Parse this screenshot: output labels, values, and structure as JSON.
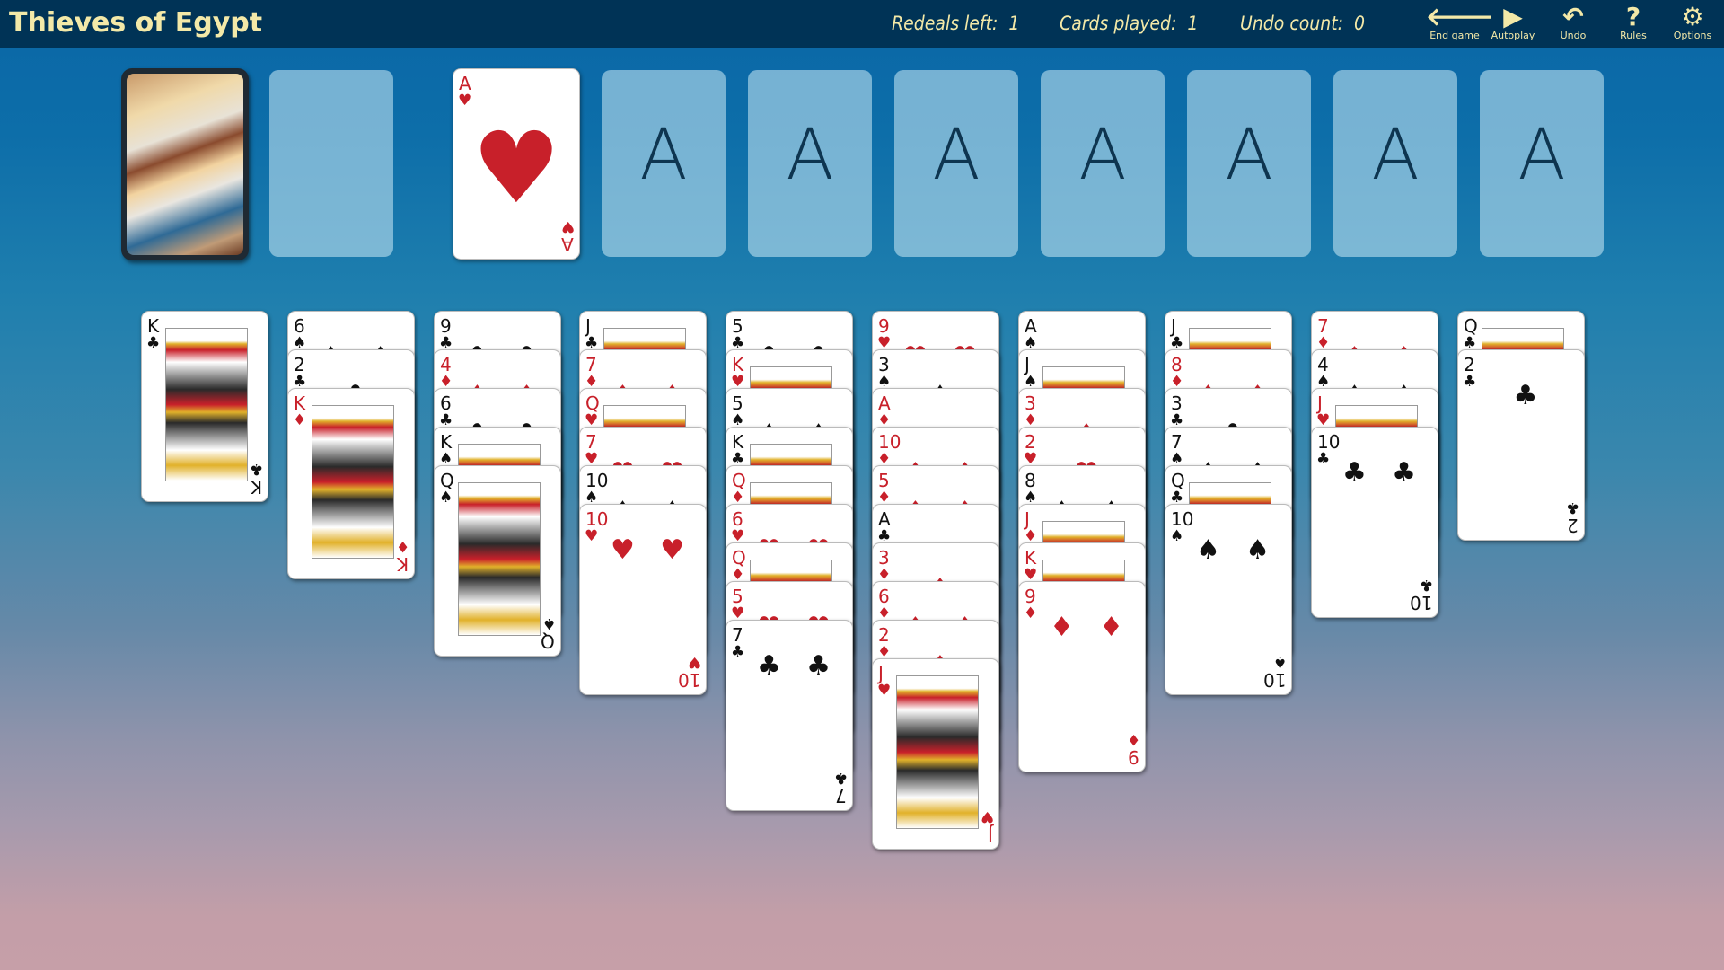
{
  "app": {
    "title": "Thieves of Egypt"
  },
  "stats": {
    "redeals_label": "Redeals left:",
    "redeals_value": "1",
    "played_label": "Cards played:",
    "played_value": "1",
    "undo_label": "Undo count:",
    "undo_value": "0"
  },
  "toolbar": [
    {
      "label": "End game",
      "icon": "arrow-left-icon",
      "glyph": "🡐"
    },
    {
      "label": "Autoplay",
      "icon": "play-icon",
      "glyph": "▶"
    },
    {
      "label": "Undo",
      "icon": "undo-icon",
      "glyph": "↶"
    },
    {
      "label": "Rules",
      "icon": "question-icon",
      "glyph": "?"
    },
    {
      "label": "Options",
      "icon": "gear-icon",
      "glyph": "⚙"
    }
  ],
  "foundation_placeholder": "A",
  "waste_top": {
    "rank": "A",
    "suit": "♥",
    "color": "red"
  },
  "suit_colors": {
    "red": "#c8202a",
    "black": "#111111"
  },
  "tableau": [
    [
      {
        "r": "K",
        "s": "♣"
      }
    ],
    [
      {
        "r": "6",
        "s": "♠"
      },
      {
        "r": "2",
        "s": "♣"
      },
      {
        "r": "K",
        "s": "♦"
      }
    ],
    [
      {
        "r": "9",
        "s": "♣"
      },
      {
        "r": "4",
        "s": "♦"
      },
      {
        "r": "6",
        "s": "♣"
      },
      {
        "r": "K",
        "s": "♠"
      },
      {
        "r": "Q",
        "s": "♠"
      }
    ],
    [
      {
        "r": "J",
        "s": "♣"
      },
      {
        "r": "7",
        "s": "♦"
      },
      {
        "r": "Q",
        "s": "♥"
      },
      {
        "r": "7",
        "s": "♥"
      },
      {
        "r": "10",
        "s": "♠"
      },
      {
        "r": "10",
        "s": "♥"
      }
    ],
    [
      {
        "r": "5",
        "s": "♣"
      },
      {
        "r": "K",
        "s": "♥"
      },
      {
        "r": "5",
        "s": "♠"
      },
      {
        "r": "K",
        "s": "♣"
      },
      {
        "r": "Q",
        "s": "♦"
      },
      {
        "r": "6",
        "s": "♥"
      },
      {
        "r": "Q",
        "s": "♦"
      },
      {
        "r": "5",
        "s": "♥"
      },
      {
        "r": "7",
        "s": "♣"
      }
    ],
    [
      {
        "r": "9",
        "s": "♥"
      },
      {
        "r": "3",
        "s": "♠"
      },
      {
        "r": "A",
        "s": "♦"
      },
      {
        "r": "10",
        "s": "♦"
      },
      {
        "r": "5",
        "s": "♦"
      },
      {
        "r": "A",
        "s": "♣"
      },
      {
        "r": "3",
        "s": "♦"
      },
      {
        "r": "6",
        "s": "♦"
      },
      {
        "r": "2",
        "s": "♦"
      },
      {
        "r": "J",
        "s": "♥"
      }
    ],
    [
      {
        "r": "A",
        "s": "♠"
      },
      {
        "r": "J",
        "s": "♠"
      },
      {
        "r": "3",
        "s": "♦"
      },
      {
        "r": "2",
        "s": "♥"
      },
      {
        "r": "8",
        "s": "♠"
      },
      {
        "r": "J",
        "s": "♦"
      },
      {
        "r": "K",
        "s": "♥"
      },
      {
        "r": "9",
        "s": "♦"
      }
    ],
    [
      {
        "r": "J",
        "s": "♣"
      },
      {
        "r": "8",
        "s": "♦"
      },
      {
        "r": "3",
        "s": "♣"
      },
      {
        "r": "7",
        "s": "♠"
      },
      {
        "r": "Q",
        "s": "♣"
      },
      {
        "r": "10",
        "s": "♠"
      }
    ],
    [
      {
        "r": "7",
        "s": "♦"
      },
      {
        "r": "4",
        "s": "♠"
      },
      {
        "r": "J",
        "s": "♥"
      },
      {
        "r": "10",
        "s": "♣"
      }
    ],
    [
      {
        "r": "Q",
        "s": "♣"
      },
      {
        "r": "2",
        "s": "♣"
      }
    ]
  ]
}
